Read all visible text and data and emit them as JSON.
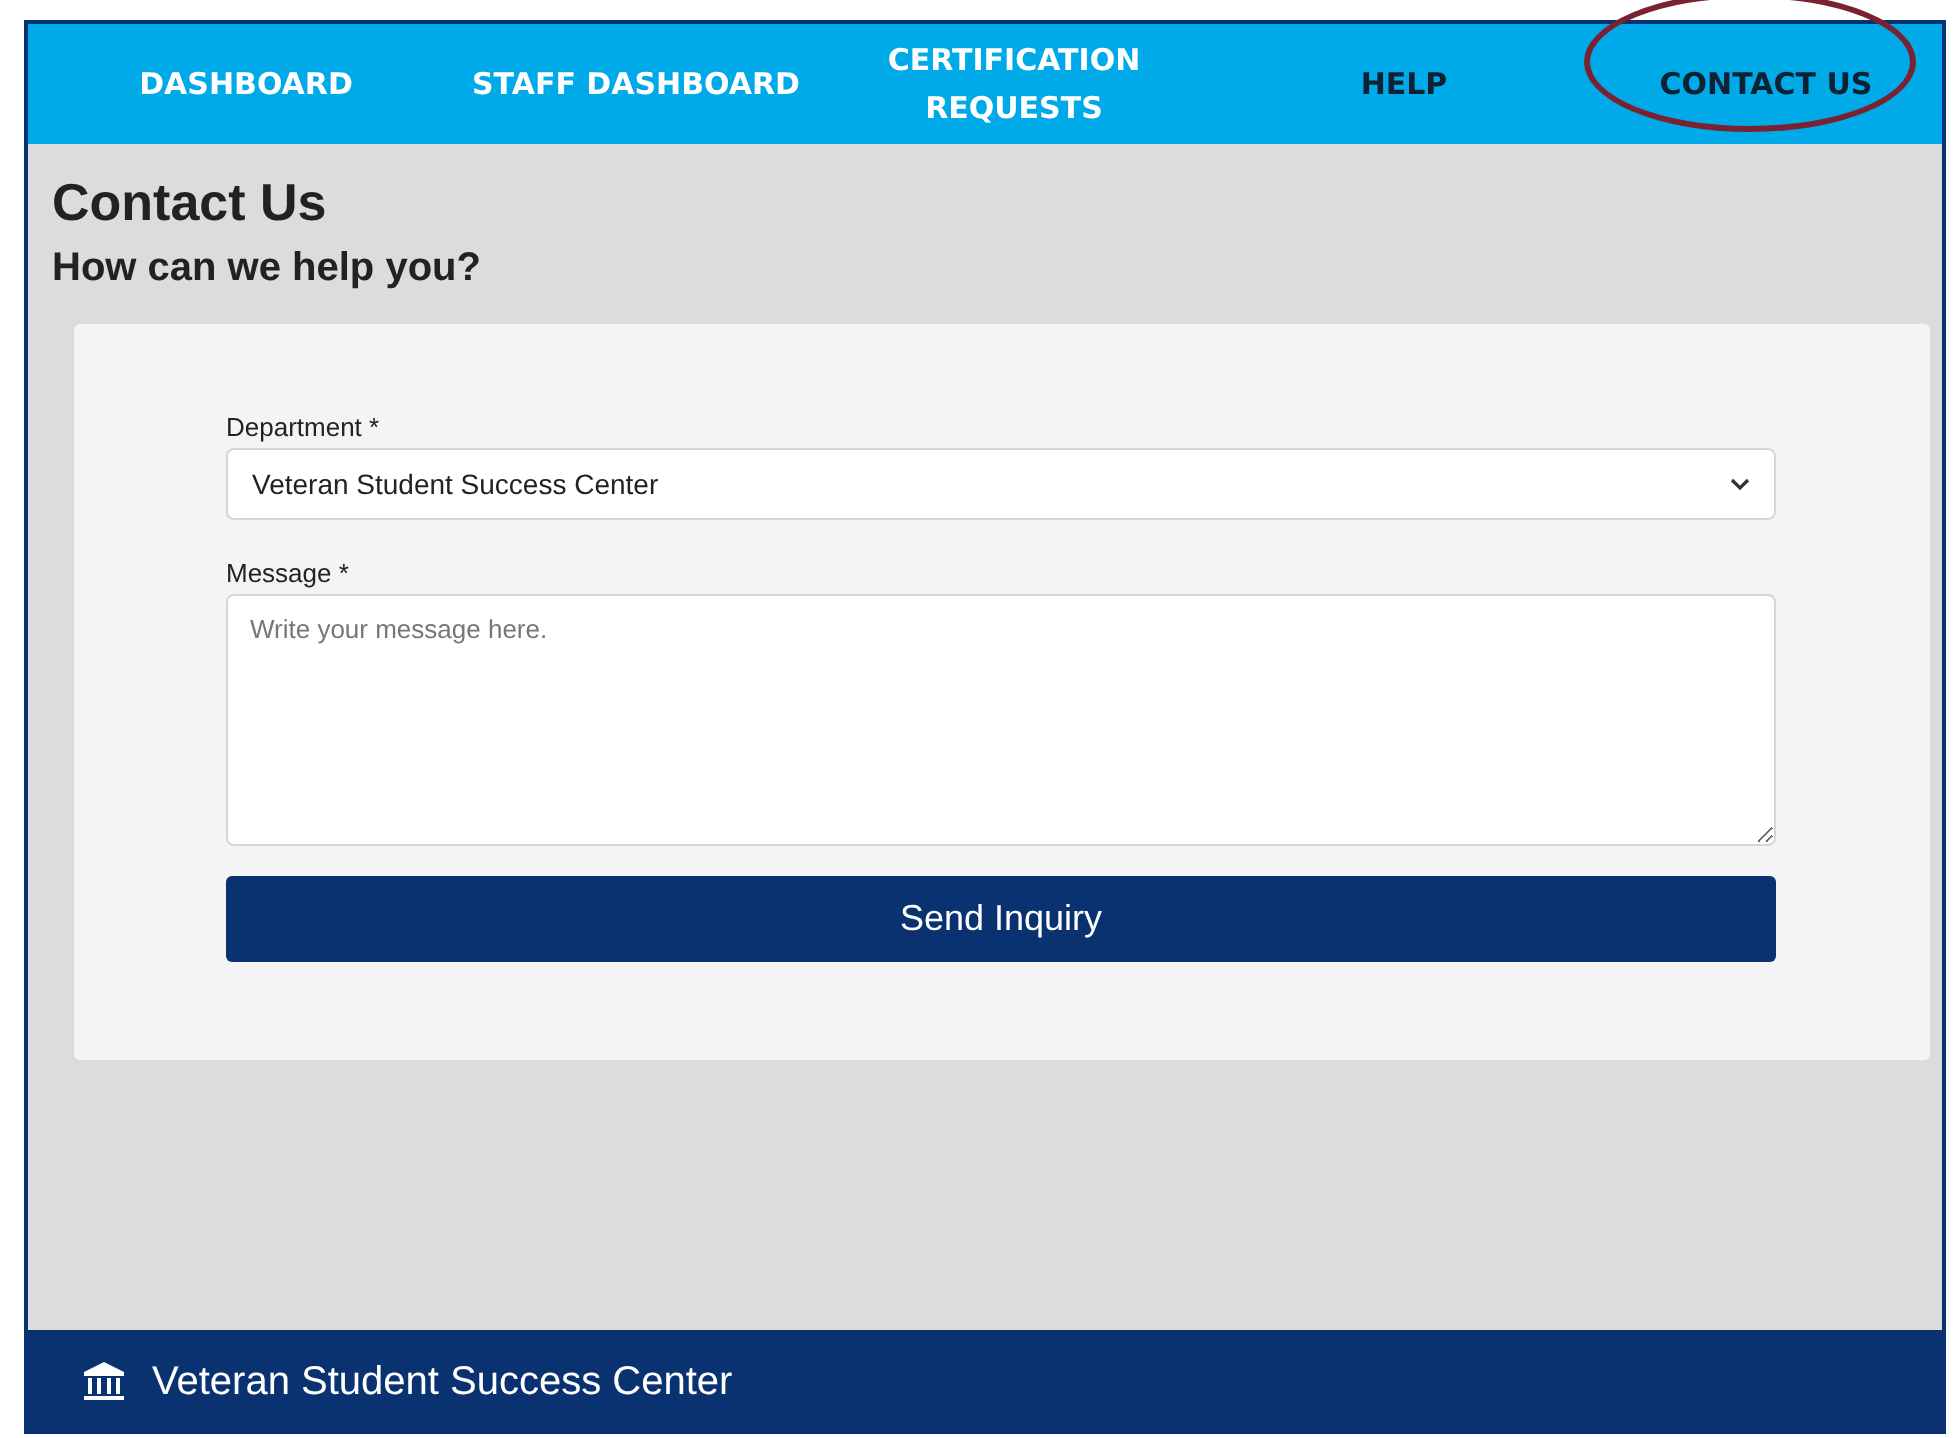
{
  "nav": {
    "items": [
      {
        "label": "DASHBOARD",
        "selected": false
      },
      {
        "label": "STAFF DASHBOARD",
        "selected": false
      },
      {
        "label": "CERTIFICATION REQUESTS",
        "selected": false
      },
      {
        "label": "HELP",
        "selected": true
      },
      {
        "label": "CONTACT US",
        "selected": true,
        "annotation": {
          "kind": "ellipse",
          "color": "#7b2230"
        }
      }
    ]
  },
  "page": {
    "title": "Contact Us",
    "subtitle": "How can we help you?"
  },
  "form": {
    "department": {
      "label": "Department *",
      "value": "Veteran Student Success Center"
    },
    "message": {
      "label": "Message *",
      "placeholder": "Write your message here."
    },
    "submit": "Send Inquiry"
  },
  "footer": {
    "title": "Veteran Student Success Center"
  }
}
